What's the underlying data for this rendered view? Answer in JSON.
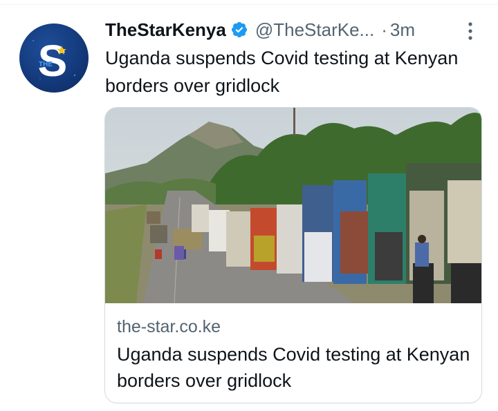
{
  "tweet": {
    "author_name": "TheStarKenya",
    "handle": "@TheStarKe...",
    "separator": "·",
    "time": "3m",
    "text": "Uganda suspends Covid testing at Kenyan borders over gridlock",
    "avatar_letter": "S",
    "avatar_badge": "THE"
  },
  "card": {
    "domain": "the-star.co.ke",
    "title": "Uganda suspends Covid testing at Kenyan borders over gridlock"
  },
  "icons": {
    "verified": "verified-badge-icon",
    "more": "more-options-icon"
  },
  "colors": {
    "text": "#0f1419",
    "secondary": "#536471",
    "verified_blue": "#1d9bf0",
    "border": "#cfd9de"
  }
}
